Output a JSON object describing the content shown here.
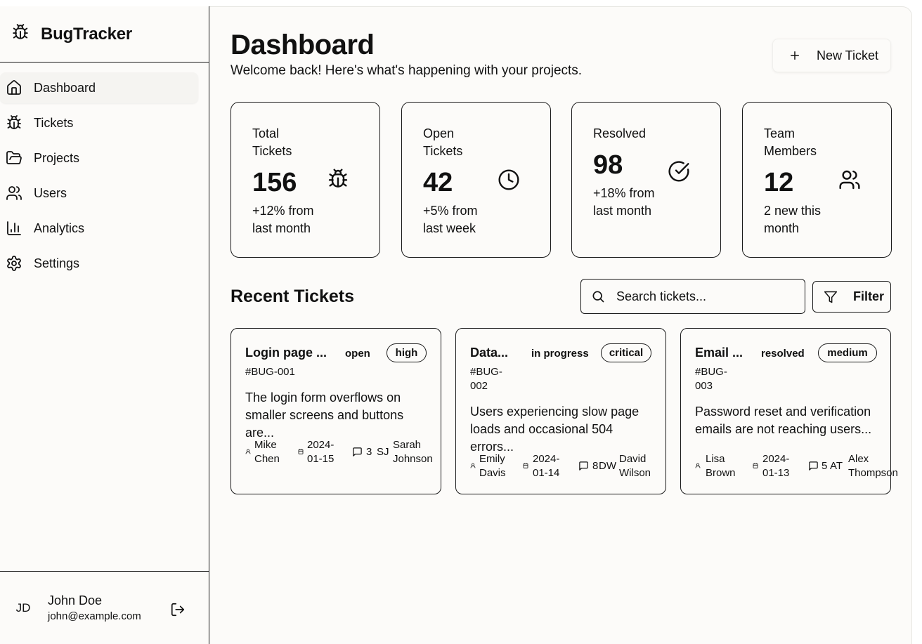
{
  "app": {
    "name": "BugTracker"
  },
  "sidebar": {
    "items": [
      {
        "label": "Dashboard",
        "icon": "home-icon",
        "active": true
      },
      {
        "label": "Tickets",
        "icon": "bug-icon"
      },
      {
        "label": "Projects",
        "icon": "folder-icon"
      },
      {
        "label": "Users",
        "icon": "users-icon"
      },
      {
        "label": "Analytics",
        "icon": "bar-chart-icon"
      },
      {
        "label": "Settings",
        "icon": "gear-icon"
      }
    ],
    "user": {
      "initials": "JD",
      "name": "John Doe",
      "email": "john@example.com"
    }
  },
  "header": {
    "title": "Dashboard",
    "subtitle": "Welcome back! Here's what's happening with your projects.",
    "new_ticket_label": "New Ticket"
  },
  "stats": [
    {
      "label": "Total Tickets",
      "value": "156",
      "sub": "+12% from last month",
      "icon": "bug-icon"
    },
    {
      "label": "Open Tickets",
      "value": "42",
      "sub": "+5% from last week",
      "icon": "clock-icon"
    },
    {
      "label": "Resolved",
      "value": "98",
      "sub": "+18% from last month",
      "icon": "check-circle-icon"
    },
    {
      "label": "Team Members",
      "value": "12",
      "sub": "2 new this month",
      "icon": "users-icon"
    }
  ],
  "recent": {
    "title": "Recent Tickets",
    "search_placeholder": "Search tickets...",
    "filter_label": "Filter"
  },
  "tickets": [
    {
      "title": "Login page ...",
      "status": "open",
      "priority": "high",
      "id": "#BUG-001",
      "description": "The login form overflows on smaller screens and buttons are...",
      "reporter": "Mike Chen",
      "date": "2024-01-15",
      "comments": "3",
      "assignee_initials": "SJ",
      "assignee": "Sarah Johnson"
    },
    {
      "title": "Data...",
      "status": "in progress",
      "priority": "critical",
      "id": "#BUG-002",
      "description": "Users experiencing slow page loads and occasional 504 errors...",
      "reporter": "Emily Davis",
      "date": "2024-01-14",
      "comments": "8",
      "assignee_initials": "DW",
      "assignee": "David Wilson"
    },
    {
      "title": "Email ...",
      "status": "resolved",
      "priority": "medium",
      "id": "#BUG-003",
      "description": "Password reset and verification emails are not reaching users...",
      "reporter": "Lisa Brown",
      "date": "2024-01-13",
      "comments": "5",
      "assignee_initials": "AT",
      "assignee": "Alex Thompson"
    }
  ]
}
